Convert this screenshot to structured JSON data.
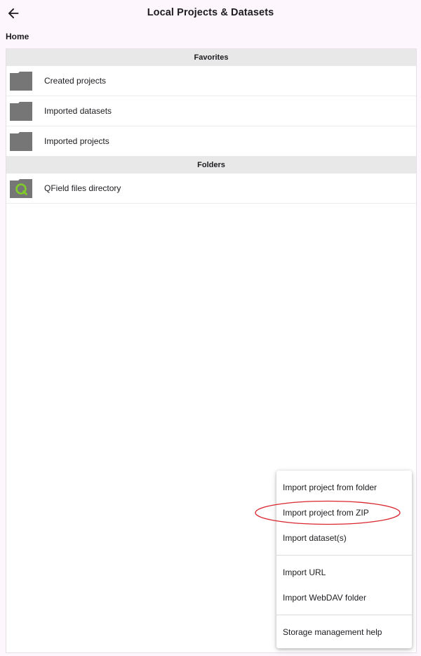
{
  "header": {
    "title": "Local Projects & Datasets",
    "back_icon": "arrow-left-icon"
  },
  "breadcrumb": "Home",
  "favorites": {
    "header": "Favorites",
    "items": [
      {
        "label": "Created projects",
        "icon": "folder-icon"
      },
      {
        "label": "Imported datasets",
        "icon": "folder-icon"
      },
      {
        "label": "Imported projects",
        "icon": "folder-icon"
      }
    ]
  },
  "folders": {
    "header": "Folders",
    "items": [
      {
        "label": "QField files directory",
        "icon": "qfield-folder-icon"
      }
    ]
  },
  "menu": {
    "items": [
      "Import project from folder",
      "Import project from ZIP",
      "Import dataset(s)",
      "Import URL",
      "Import WebDAV folder",
      "Storage management help"
    ]
  },
  "colors": {
    "background": "#fdf7fd",
    "section_header": "#e8e8e8",
    "folder": "#767676",
    "qfield_accent": "#80cc28",
    "annotation": "#d9262f"
  }
}
